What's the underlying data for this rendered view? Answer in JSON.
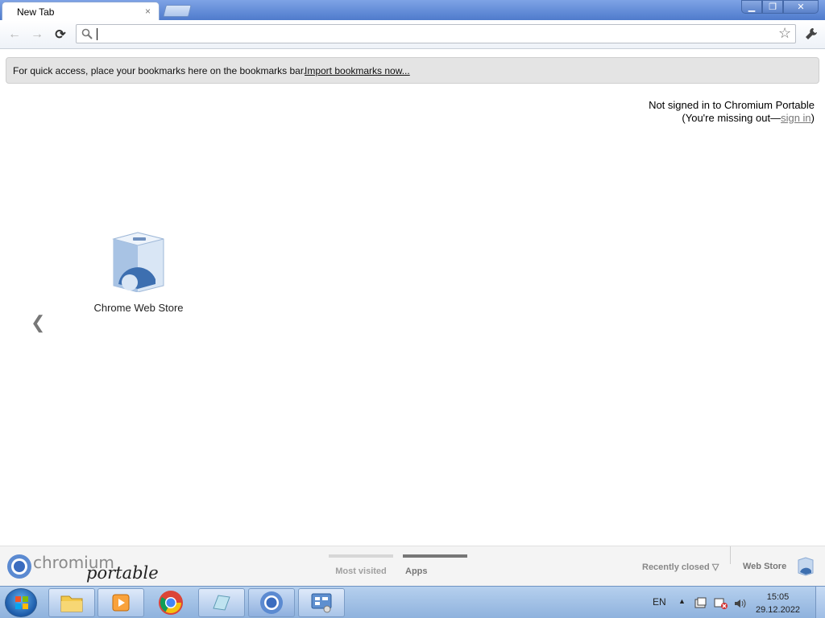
{
  "browser": {
    "tab_title": "New Tab",
    "tab_close_glyph": "×",
    "window_buttons": {
      "minimize": "▁",
      "restore": "❐",
      "close": "✕"
    }
  },
  "toolbar": {
    "back_glyph": "←",
    "forward_glyph": "→",
    "reload_glyph": "⟳",
    "omnibox_value": "",
    "star_glyph": "☆"
  },
  "bookmarks_bar": {
    "message": "For quick access, place your bookmarks here on the bookmarks bar.",
    "import_link": "Import bookmarks now..."
  },
  "signin": {
    "line1": "Not signed in to Chromium Portable",
    "line2_prefix": "(You're missing out—",
    "link": "sign in",
    "line2_suffix": ")"
  },
  "apps": [
    {
      "name": "Chrome Web Store",
      "icon": "web-store-icon"
    }
  ],
  "prev_page_glyph": "❮",
  "footer": {
    "logo_word1": "chromium",
    "logo_word2": "portable",
    "tabs": [
      {
        "label": "Most visited",
        "active": false
      },
      {
        "label": "Apps",
        "active": true
      }
    ],
    "recently_closed": "Recently closed",
    "web_store": "Web Store"
  },
  "taskbar": {
    "language": "EN",
    "time": "15:05",
    "date": "29.12.2022",
    "buttons": [
      "file-explorer-icon",
      "media-player-icon",
      "chrome-icon",
      "notepad-icon",
      "chromium-icon",
      "control-panel-icon"
    ]
  },
  "colors": {
    "titlebar": "#5e87d0",
    "accent_link": "#777777"
  }
}
